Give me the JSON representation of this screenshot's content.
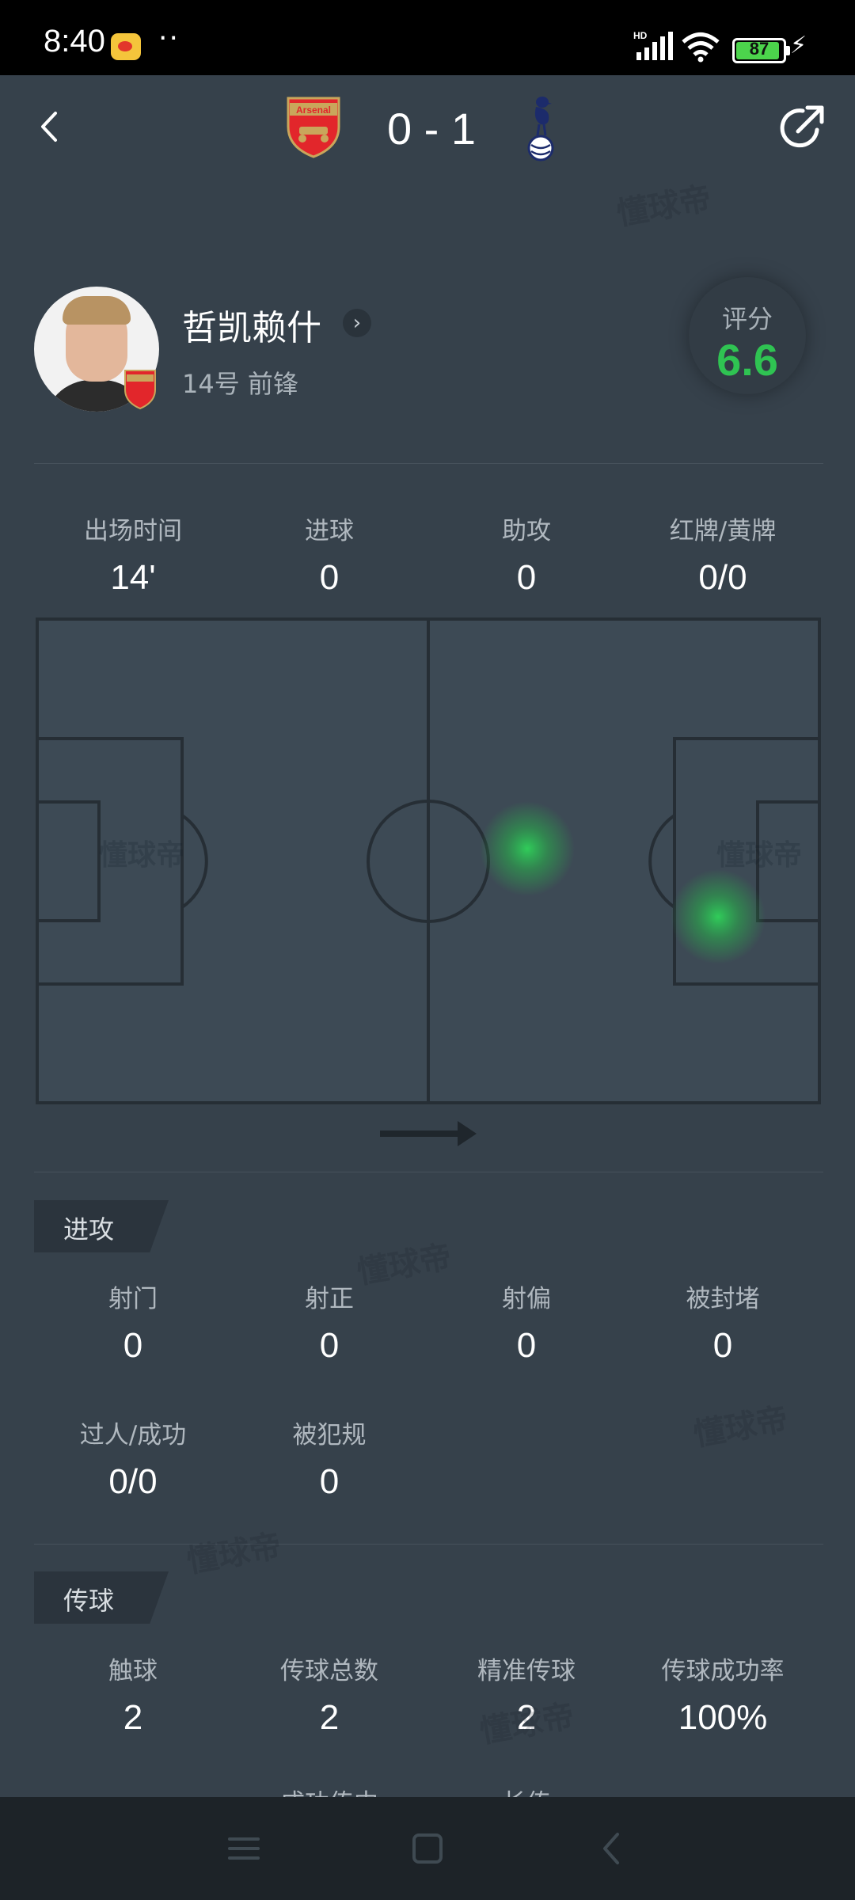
{
  "status_bar": {
    "time": "8:40",
    "dots": "··",
    "network": "HD",
    "battery": "87",
    "icons": [
      "weibo-icon",
      "signal-icon",
      "wifi-icon",
      "battery-icon",
      "charging-icon"
    ]
  },
  "header": {
    "score": "0 - 1",
    "home_badge_text": "Arsenal",
    "icons": [
      "back-icon",
      "arsenal-badge-icon",
      "tottenham-badge-icon",
      "share-icon"
    ]
  },
  "player": {
    "name": "哲凯赖什",
    "info": "14号 前锋",
    "rating_label": "评分",
    "rating_value": "6.6",
    "rating_color": "#2fc352"
  },
  "summary": [
    {
      "label": "出场时间",
      "value": "14'"
    },
    {
      "label": "进球",
      "value": "0"
    },
    {
      "label": "助攻",
      "value": "0"
    },
    {
      "label": "红牌/黄牌",
      "value": "0/0"
    }
  ],
  "heatmap": {
    "watermark": "懂球帝",
    "attack_direction": "right"
  },
  "attack": {
    "title": "进攻",
    "stats": [
      {
        "label": "射门",
        "value": "0"
      },
      {
        "label": "射正",
        "value": "0"
      },
      {
        "label": "射偏",
        "value": "0"
      },
      {
        "label": "被封堵",
        "value": "0"
      },
      {
        "label": "过人/成功",
        "value": "0/0"
      },
      {
        "label": "被犯规",
        "value": "0"
      }
    ]
  },
  "passing": {
    "title": "传球",
    "stats": [
      {
        "label": "触球",
        "value": "2"
      },
      {
        "label": "传球总数",
        "value": "2"
      },
      {
        "label": "精准传球",
        "value": "2"
      },
      {
        "label": "传球成功率",
        "value": "100%"
      }
    ],
    "partial_labels": [
      "成功传中",
      "长传"
    ]
  },
  "nav_bar": {
    "icons": [
      "menu-icon",
      "home-icon",
      "back-nav-icon"
    ]
  }
}
